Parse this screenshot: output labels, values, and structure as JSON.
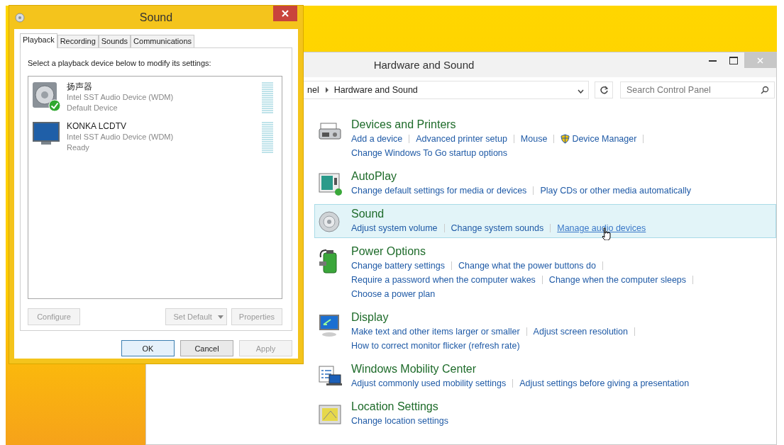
{
  "sound_dialog": {
    "title": "Sound",
    "tabs": [
      {
        "label": "Playback",
        "selected": true
      },
      {
        "label": "Recording",
        "selected": false
      },
      {
        "label": "Sounds",
        "selected": false
      },
      {
        "label": "Communications",
        "selected": false
      }
    ],
    "instruction": "Select a playback device below to modify its settings:",
    "devices": [
      {
        "kind": "speaker",
        "name": "扬声器",
        "driver": "Intel SST Audio Device (WDM)",
        "status": "Default Device",
        "default": true
      },
      {
        "kind": "tv",
        "name": "KONKA LCDTV",
        "driver": "Intel SST Audio Device (WDM)",
        "status": "Ready",
        "default": false
      }
    ],
    "device_buttons": [
      {
        "kind": "plain",
        "label": "Configure",
        "disabled": true
      },
      {
        "kind": "split",
        "label": "Set Default",
        "disabled": true
      },
      {
        "kind": "plain",
        "label": "Properties",
        "disabled": true
      }
    ],
    "footer_buttons": [
      {
        "label": "OK",
        "default": true,
        "disabled": false
      },
      {
        "label": "Cancel",
        "default": false,
        "disabled": false
      },
      {
        "label": "Apply",
        "default": false,
        "disabled": true
      }
    ]
  },
  "control_panel": {
    "title": "Hardware and Sound",
    "breadcrumb": [
      "nel",
      "Hardware and Sound"
    ],
    "search": {
      "placeholder": "Search Control Panel"
    },
    "categories": [
      {
        "kind": "printer",
        "title": "Devices and Printers",
        "highlighted": false,
        "lines": [
          [
            {
              "label": "Add a device",
              "shield": false,
              "hovered": false
            },
            {
              "label": "Advanced printer setup",
              "shield": false,
              "hovered": false
            },
            {
              "label": "Mouse",
              "shield": false,
              "hovered": false
            },
            {
              "label": "Device Manager",
              "shield": true,
              "hovered": false
            }
          ],
          [
            {
              "label": "Change Windows To Go startup options",
              "shield": false,
              "hovered": false
            }
          ]
        ]
      },
      {
        "kind": "autoplay",
        "title": "AutoPlay",
        "highlighted": false,
        "lines": [
          [
            {
              "label": "Change default settings for media or devices",
              "shield": false,
              "hovered": false
            },
            {
              "label": "Play CDs or other media automatically",
              "shield": false,
              "hovered": false
            }
          ]
        ]
      },
      {
        "kind": "sound",
        "title": "Sound",
        "highlighted": true,
        "lines": [
          [
            {
              "label": "Adjust system volume",
              "shield": false,
              "hovered": false
            },
            {
              "label": "Change system sounds",
              "shield": false,
              "hovered": false
            },
            {
              "label": "Manage audio devices",
              "shield": false,
              "hovered": true
            }
          ]
        ]
      },
      {
        "kind": "power",
        "title": "Power Options",
        "highlighted": false,
        "lines": [
          [
            {
              "label": "Change battery settings",
              "shield": false,
              "hovered": false
            },
            {
              "label": "Change what the power buttons do",
              "shield": false,
              "hovered": false
            }
          ],
          [
            {
              "label": "Require a password when the computer wakes",
              "shield": false,
              "hovered": false
            },
            {
              "label": "Change when the computer sleeps",
              "shield": false,
              "hovered": false
            }
          ],
          [
            {
              "label": "Choose a power plan",
              "shield": false,
              "hovered": false
            }
          ]
        ]
      },
      {
        "kind": "display",
        "title": "Display",
        "highlighted": false,
        "lines": [
          [
            {
              "label": "Make text and other items larger or smaller",
              "shield": false,
              "hovered": false
            },
            {
              "label": "Adjust screen resolution",
              "shield": false,
              "hovered": false
            }
          ],
          [
            {
              "label": "How to correct monitor flicker (refresh rate)",
              "shield": false,
              "hovered": false
            }
          ]
        ]
      },
      {
        "kind": "mobility",
        "title": "Windows Mobility Center",
        "highlighted": false,
        "lines": [
          [
            {
              "label": "Adjust commonly used mobility settings",
              "shield": false,
              "hovered": false
            },
            {
              "label": "Adjust settings before giving a presentation",
              "shield": false,
              "hovered": false
            }
          ]
        ]
      },
      {
        "kind": "location",
        "title": "Location Settings",
        "highlighted": false,
        "lines": [
          [
            {
              "label": "Change location settings",
              "shield": false,
              "hovered": false
            }
          ]
        ]
      }
    ]
  }
}
